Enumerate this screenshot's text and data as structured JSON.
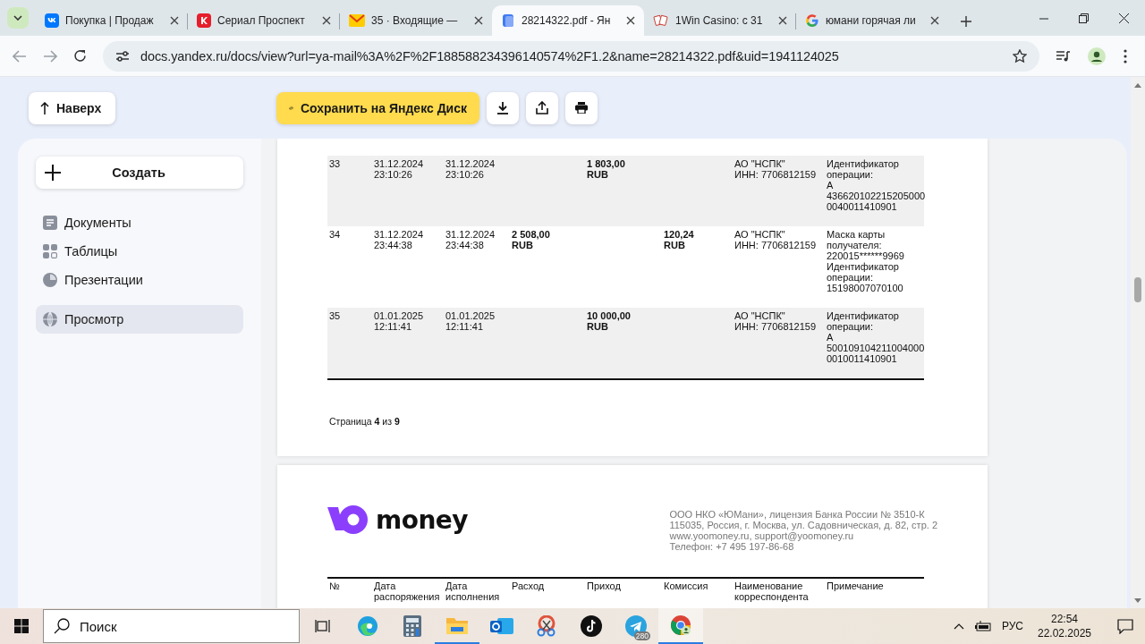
{
  "browser": {
    "tabs": [
      {
        "title": "Покупка | Продаж",
        "kind": "vk",
        "selected": false
      },
      {
        "title": "Сериал Проспект",
        "kind": "kinopoisk",
        "selected": false
      },
      {
        "title": "35 · Входящие —",
        "kind": "mail",
        "selected": false
      },
      {
        "title": "28214322.pdf - Ян",
        "kind": "docs",
        "selected": true
      },
      {
        "title": "1Win Casino: с 31",
        "kind": "casino",
        "selected": false
      },
      {
        "title": "юмани горячая ли",
        "kind": "google",
        "selected": false
      }
    ],
    "url": "docs.yandex.ru/docs/view?url=ya-mail%3A%2F%2F188588234396140574%2F1.2&name=28214322.pdf&uid=1941124025"
  },
  "toolbar": {
    "back_button": "Наверх",
    "save_button": "Сохранить на Яндекс Диск"
  },
  "sidebar": {
    "create_button": "Создать",
    "items": [
      {
        "label": "Документы",
        "kind": "document",
        "selected": false
      },
      {
        "label": "Таблицы",
        "kind": "table",
        "selected": false
      },
      {
        "label": "Презентации",
        "kind": "presentation",
        "selected": false
      },
      {
        "label": "Просмотр",
        "kind": "view",
        "selected": true
      }
    ]
  },
  "document": {
    "rows": [
      {
        "number": "33",
        "order_date": "31.12.2024\n23:10:26",
        "exec_date": "31.12.2024\n23:10:26",
        "expense": "",
        "income": "1 803,00\nRUB",
        "fee": "",
        "correspondent": "АО \"НСПК\"\nИНН: 7706812159",
        "note": "Идентификатор\nоперации:\nА\n436620102215205000\n0040011410901"
      },
      {
        "number": "34",
        "order_date": "31.12.2024\n23:44:38",
        "exec_date": "31.12.2024\n23:44:38",
        "expense": "2 508,00\nRUB",
        "income": "",
        "fee": "120,24\nRUB",
        "correspondent": "АО \"НСПК\"\nИНН: 7706812159",
        "note": "Маска карты\nполучателя:\n220015******9969\nИдентификатор\nоперации:\n15198007070100"
      },
      {
        "number": "35",
        "order_date": "01.01.2025\n12:11:41",
        "exec_date": "01.01.2025\n12:11:41",
        "expense": "",
        "income": "10 000,00\nRUB",
        "fee": "",
        "correspondent": "АО \"НСПК\"\nИНН: 7706812159",
        "note": "Идентификатор\nоперации:\nА\n500109104211004000\n0010011410901"
      }
    ],
    "page_footer": "Страница **4** из **9**",
    "letterhead": {
      "logo_text": "money",
      "company_lines": [
        "ООО НКО «ЮМани», лицензия Банка России № 3510-К",
        "115035, Россия, г. Москва, ул. Садовническая, д. 82, стр. 2",
        "www.yoomoney.ru, support@yoomoney.ru",
        "Телефон: +7 495 197-86-68"
      ]
    },
    "columns": [
      "№",
      "Дата\nраспоряжения",
      "Дата\nисполнения",
      "Расход",
      "Приход",
      "Комиссия",
      "Наименование\nкорреспондента",
      "Примечание"
    ]
  },
  "taskbar": {
    "search_placeholder": "Поиск",
    "apps": [
      {
        "kind": "taskview",
        "open": false,
        "selected": false
      },
      {
        "kind": "edge",
        "open": false,
        "selected": false
      },
      {
        "kind": "calculator",
        "open": false,
        "selected": false
      },
      {
        "kind": "files",
        "open": true,
        "selected": false
      },
      {
        "kind": "outlook",
        "open": false,
        "selected": false
      },
      {
        "kind": "snip",
        "open": false,
        "selected": false
      },
      {
        "kind": "tiktok",
        "open": false,
        "selected": false
      },
      {
        "kind": "telegram",
        "open": false,
        "selected": false,
        "badge": "280"
      },
      {
        "kind": "chrome",
        "open": true,
        "selected": true
      }
    ],
    "language": "РУС",
    "time": "22:54",
    "date": "22.02.2025"
  }
}
